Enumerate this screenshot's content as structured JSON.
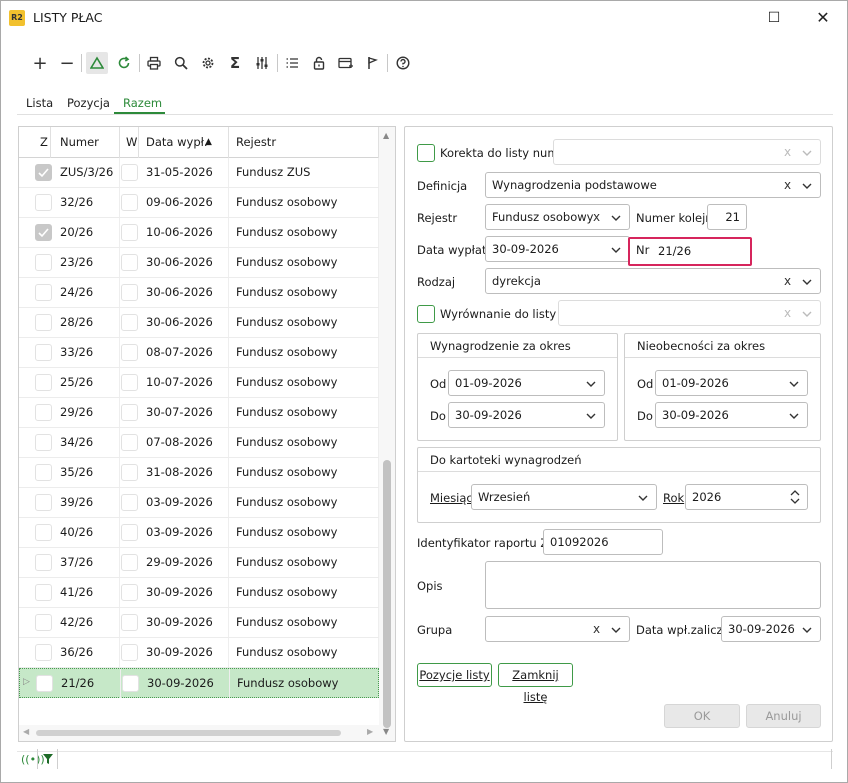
{
  "window": {
    "title": "LISTY PŁAC",
    "icon_text": "R2"
  },
  "toolbar": {
    "icons": [
      "plus-icon",
      "minus-icon",
      "triangle-icon",
      "refresh-icon",
      "print-icon",
      "search-icon",
      "gear-icon",
      "sigma-icon",
      "sliders-icon",
      "list-icon",
      "unlock-icon",
      "card-icon",
      "flag-icon",
      "help-icon"
    ]
  },
  "tabs": [
    {
      "label": "Lista"
    },
    {
      "label": "Pozycja"
    },
    {
      "label": "Razem"
    }
  ],
  "grid": {
    "headers": {
      "z": "Z",
      "numer": "Numer",
      "w": "W",
      "data": "Data wypł.",
      "rejestr": "Rejestr"
    },
    "rows": [
      {
        "numer": "ZUS/3/26",
        "data": "31-05-2026",
        "rejestr": "Fundusz ZUS",
        "checked": true
      },
      {
        "numer": "32/26",
        "data": "09-06-2026",
        "rejestr": "Fundusz osobowy",
        "checked": false
      },
      {
        "numer": "20/26",
        "data": "10-06-2026",
        "rejestr": "Fundusz osobowy",
        "checked": true
      },
      {
        "numer": "23/26",
        "data": "30-06-2026",
        "rejestr": "Fundusz osobowy",
        "checked": false
      },
      {
        "numer": "24/26",
        "data": "30-06-2026",
        "rejestr": "Fundusz osobowy",
        "checked": false
      },
      {
        "numer": "28/26",
        "data": "30-06-2026",
        "rejestr": "Fundusz osobowy",
        "checked": false
      },
      {
        "numer": "33/26",
        "data": "08-07-2026",
        "rejestr": "Fundusz osobowy",
        "checked": false
      },
      {
        "numer": "25/26",
        "data": "10-07-2026",
        "rejestr": "Fundusz osobowy",
        "checked": false
      },
      {
        "numer": "29/26",
        "data": "30-07-2026",
        "rejestr": "Fundusz osobowy",
        "checked": false
      },
      {
        "numer": "34/26",
        "data": "07-08-2026",
        "rejestr": "Fundusz osobowy",
        "checked": false
      },
      {
        "numer": "35/26",
        "data": "31-08-2026",
        "rejestr": "Fundusz osobowy",
        "checked": false
      },
      {
        "numer": "39/26",
        "data": "03-09-2026",
        "rejestr": "Fundusz osobowy",
        "checked": false
      },
      {
        "numer": "40/26",
        "data": "03-09-2026",
        "rejestr": "Fundusz osobowy",
        "checked": false
      },
      {
        "numer": "37/26",
        "data": "29-09-2026",
        "rejestr": "Fundusz osobowy",
        "checked": false
      },
      {
        "numer": "41/26",
        "data": "30-09-2026",
        "rejestr": "Fundusz osobowy",
        "checked": false
      },
      {
        "numer": "42/26",
        "data": "30-09-2026",
        "rejestr": "Fundusz osobowy",
        "checked": false
      },
      {
        "numer": "36/26",
        "data": "30-09-2026",
        "rejestr": "Fundusz osobowy",
        "checked": false
      },
      {
        "numer": "21/26",
        "data": "30-09-2026",
        "rejestr": "Fundusz osobowy",
        "checked": false,
        "selected": true
      }
    ]
  },
  "form": {
    "korekta_label": "Korekta do listy numer",
    "definicja_label": "Definicja",
    "definicja_value": "Wynagrodzenia podstawowe",
    "rejestr_label": "Rejestr",
    "rejestr_value": "Fundusz osobowy",
    "numer_kolejny_label": "Numer kolejny",
    "numer_kolejny_value": "21",
    "data_wyplaty_label": "Data wypłaty",
    "data_wyplaty_value": "30-09-2026",
    "nr_label": "Nr",
    "nr_value": "21/26",
    "rodzaj_label": "Rodzaj",
    "rodzaj_value": "dyrekcja",
    "wyrownanie_label": "Wyrównanie do listy nr",
    "wyn_okres": {
      "title": "Wynagrodzenie za okres",
      "od_label": "Od",
      "od_value": "01-09-2026",
      "do_label": "Do",
      "do_value": "30-09-2026"
    },
    "nieob_okres": {
      "title": "Nieobecności za okres",
      "od_label": "Od",
      "od_value": "01-09-2026",
      "do_label": "Do",
      "do_value": "30-09-2026"
    },
    "kartoteka": {
      "title": "Do kartoteki wynagrodzeń",
      "miesiac_label": "Miesiąc",
      "miesiac_value": "Wrzesień",
      "rok_label": "Rok",
      "rok_value": "2026"
    },
    "zus_label": "Identyfikator raportu ZUS",
    "zus_value": "01092026",
    "opis_label": "Opis",
    "grupa_label": "Grupa",
    "data_wpl_label": "Data wpł.zaliczki",
    "data_wpl_value": "30-09-2026",
    "btn_pozycje": "Pozycje listy",
    "btn_zamknij": "Zamknij listę",
    "btn_ok": "OK",
    "btn_anuluj": "Anuluj",
    "clear_glyph": "x"
  },
  "colors": {
    "accent": "#2d8a3a",
    "highlight": "#d6255c",
    "selected_row": "#c6e8c8"
  }
}
